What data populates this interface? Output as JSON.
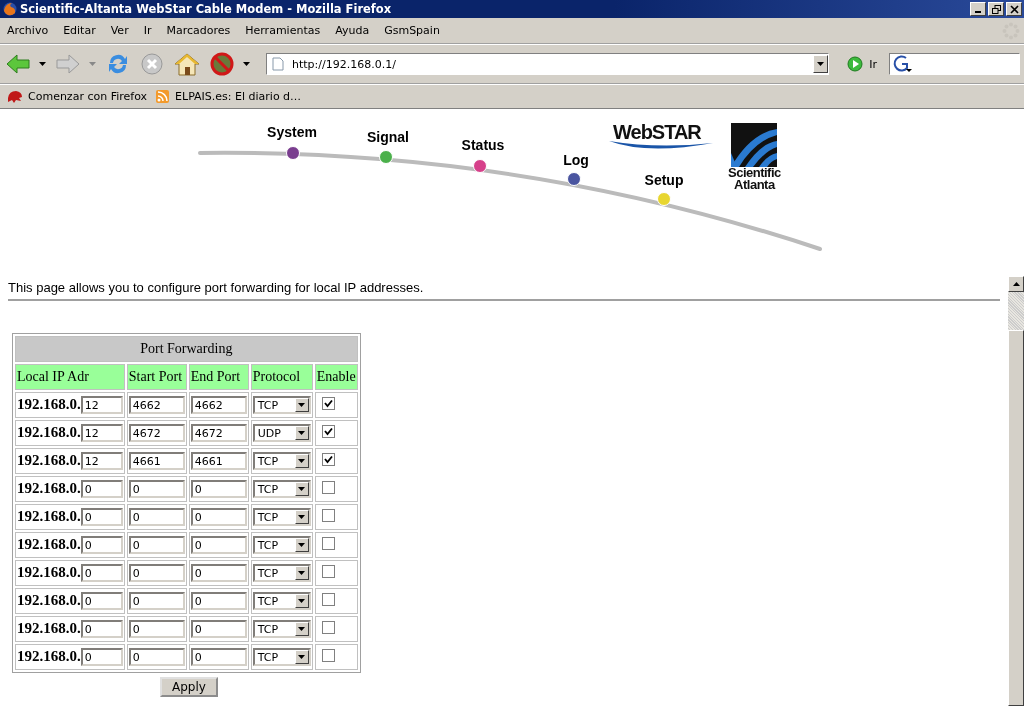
{
  "window": {
    "title": "Scientific-Altanta WebStar Cable Modem - Mozilla Firefox"
  },
  "menu": [
    "Archivo",
    "Editar",
    "Ver",
    "Ir",
    "Marcadores",
    "Herramientas",
    "Ayuda",
    "GsmSpain"
  ],
  "address": {
    "value": "http://192.168.0.1/"
  },
  "go_label": "Ir",
  "bookmarks": [
    "Comenzar con Firefox",
    "ELPAIS.es: El diario d…"
  ],
  "nav": [
    {
      "label": "System",
      "color": "#7a3d8f"
    },
    {
      "label": "Signal",
      "color": "#4bb04b"
    },
    {
      "label": "Status",
      "color": "#d6408a"
    },
    {
      "label": "Log",
      "color": "#4a55a0"
    },
    {
      "label": "Setup",
      "color": "#e8d630"
    }
  ],
  "brand": {
    "product": "WebSTAR",
    "company_line_1": "Scientific",
    "company_line_2": "Atlanta"
  },
  "intro": "This page allows you to configure port forwarding for local IP addresses.",
  "table": {
    "title": "Port Forwarding",
    "columns": [
      "Local IP Adr",
      "Start Port",
      "End Port",
      "Protocol",
      "Enable"
    ],
    "rows": [
      {
        "ip_prefix": "192.168.0.",
        "ip_suffix": "12",
        "start_port": "4662",
        "end_port": "4662",
        "protocol": "TCP",
        "checked": true
      },
      {
        "ip_prefix": "192.168.0.",
        "ip_suffix": "12",
        "start_port": "4672",
        "end_port": "4672",
        "protocol": "UDP",
        "checked": true
      },
      {
        "ip_prefix": "192.168.0.",
        "ip_suffix": "12",
        "start_port": "4661",
        "end_port": "4661",
        "protocol": "TCP",
        "checked": true
      },
      {
        "ip_prefix": "192.168.0.",
        "ip_suffix": "0",
        "start_port": "0",
        "end_port": "0",
        "protocol": "TCP",
        "checked": false
      },
      {
        "ip_prefix": "192.168.0.",
        "ip_suffix": "0",
        "start_port": "0",
        "end_port": "0",
        "protocol": "TCP",
        "checked": false
      },
      {
        "ip_prefix": "192.168.0.",
        "ip_suffix": "0",
        "start_port": "0",
        "end_port": "0",
        "protocol": "TCP",
        "checked": false
      },
      {
        "ip_prefix": "192.168.0.",
        "ip_suffix": "0",
        "start_port": "0",
        "end_port": "0",
        "protocol": "TCP",
        "checked": false
      },
      {
        "ip_prefix": "192.168.0.",
        "ip_suffix": "0",
        "start_port": "0",
        "end_port": "0",
        "protocol": "TCP",
        "checked": false
      },
      {
        "ip_prefix": "192.168.0.",
        "ip_suffix": "0",
        "start_port": "0",
        "end_port": "0",
        "protocol": "TCP",
        "checked": false
      },
      {
        "ip_prefix": "192.168.0.",
        "ip_suffix": "0",
        "start_port": "0",
        "end_port": "0",
        "protocol": "TCP",
        "checked": false
      }
    ]
  },
  "apply_button": "Apply"
}
